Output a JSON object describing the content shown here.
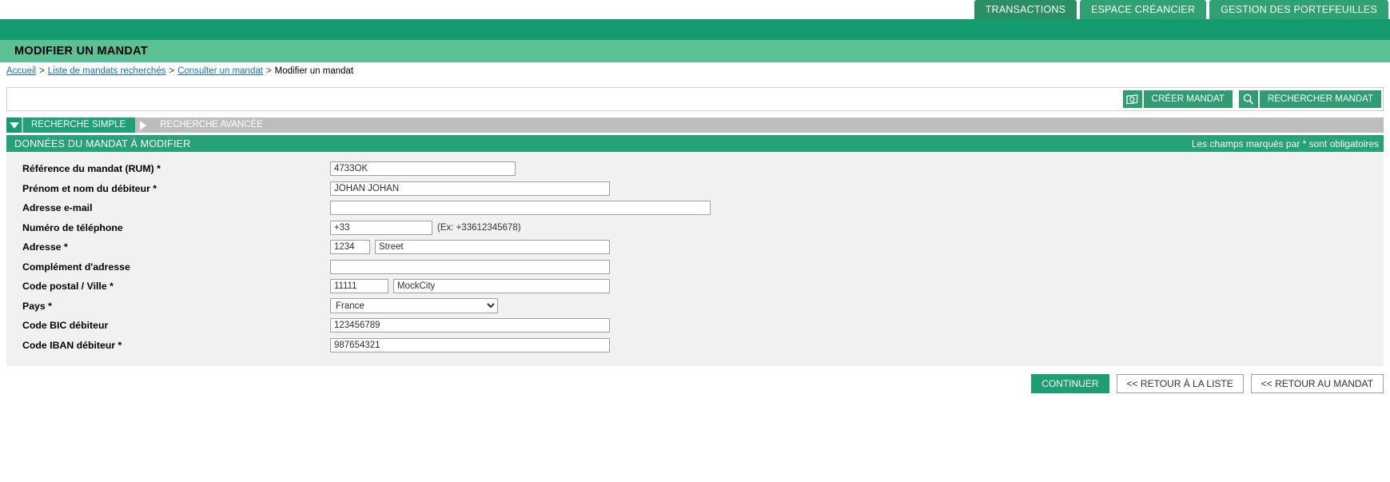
{
  "topnav": {
    "tabs": [
      {
        "label": "TRANSACTIONS",
        "active": true
      },
      {
        "label": "ESPACE CRÉANCIER",
        "active": false
      },
      {
        "label": "GESTION DES PORTEFEUILLES",
        "active": false
      }
    ]
  },
  "page": {
    "title": "MODIFIER UN MANDAT"
  },
  "breadcrumb": {
    "items": [
      {
        "label": "Accueil",
        "link": true
      },
      {
        "label": "Liste de mandats recherchés",
        "link": true
      },
      {
        "label": "Consulter un mandat",
        "link": true
      },
      {
        "label": "Modifier un mandat",
        "link": false
      }
    ],
    "separator": ">"
  },
  "toolbar": {
    "create_label": "CRÉER MANDAT",
    "create_icon": "banknote-icon",
    "search_label": "RECHERCHER MANDAT",
    "search_icon": "magnifier-icon"
  },
  "search_tabs": [
    {
      "label": "RECHERCHE SIMPLE",
      "active": true,
      "icon": "triangle-down-icon"
    },
    {
      "label": "RECHERCHE AVANCÉE",
      "active": false,
      "icon": "triangle-right-icon"
    }
  ],
  "section": {
    "title": "DONNÉES DU MANDAT À MODIFIER",
    "required_note": "Les champs marqués par * sont obligatoires"
  },
  "form": {
    "rum": {
      "label": "Référence du mandat (RUM) *",
      "value": "4733OK"
    },
    "debtor_name": {
      "label": "Prénom et nom du débiteur *",
      "value": "JOHAN JOHAN"
    },
    "email": {
      "label": "Adresse e-mail",
      "value": ""
    },
    "phone": {
      "label": "Numéro de téléphone",
      "value": "+33",
      "hint": "(Ex: +33612345678)"
    },
    "address": {
      "label": "Adresse *",
      "number": "1234",
      "street": "Street"
    },
    "address_complement": {
      "label": "Complément d'adresse",
      "value": ""
    },
    "zip_city": {
      "label": "Code postal / Ville *",
      "zip": "11111",
      "city": "MockCity"
    },
    "country": {
      "label": "Pays *",
      "value": "France",
      "options": [
        "France"
      ]
    },
    "bic": {
      "label": "Code BIC débiteur",
      "value": "123456789"
    },
    "iban": {
      "label": "Code IBAN débiteur *",
      "value": "987654321"
    }
  },
  "footer": {
    "continue_label": "CONTINUER",
    "back_to_list_label": "<< RETOUR À LA LISTE",
    "back_to_mandate_label": "<< RETOUR AU MANDAT"
  },
  "colors": {
    "brand_green": "#159b70",
    "light_green": "#5cc096",
    "tab_green": "#2fa173",
    "link_blue": "#1a6fc4",
    "panel_gray": "#f1f1f1",
    "tab_gray": "#bdbdbd"
  }
}
